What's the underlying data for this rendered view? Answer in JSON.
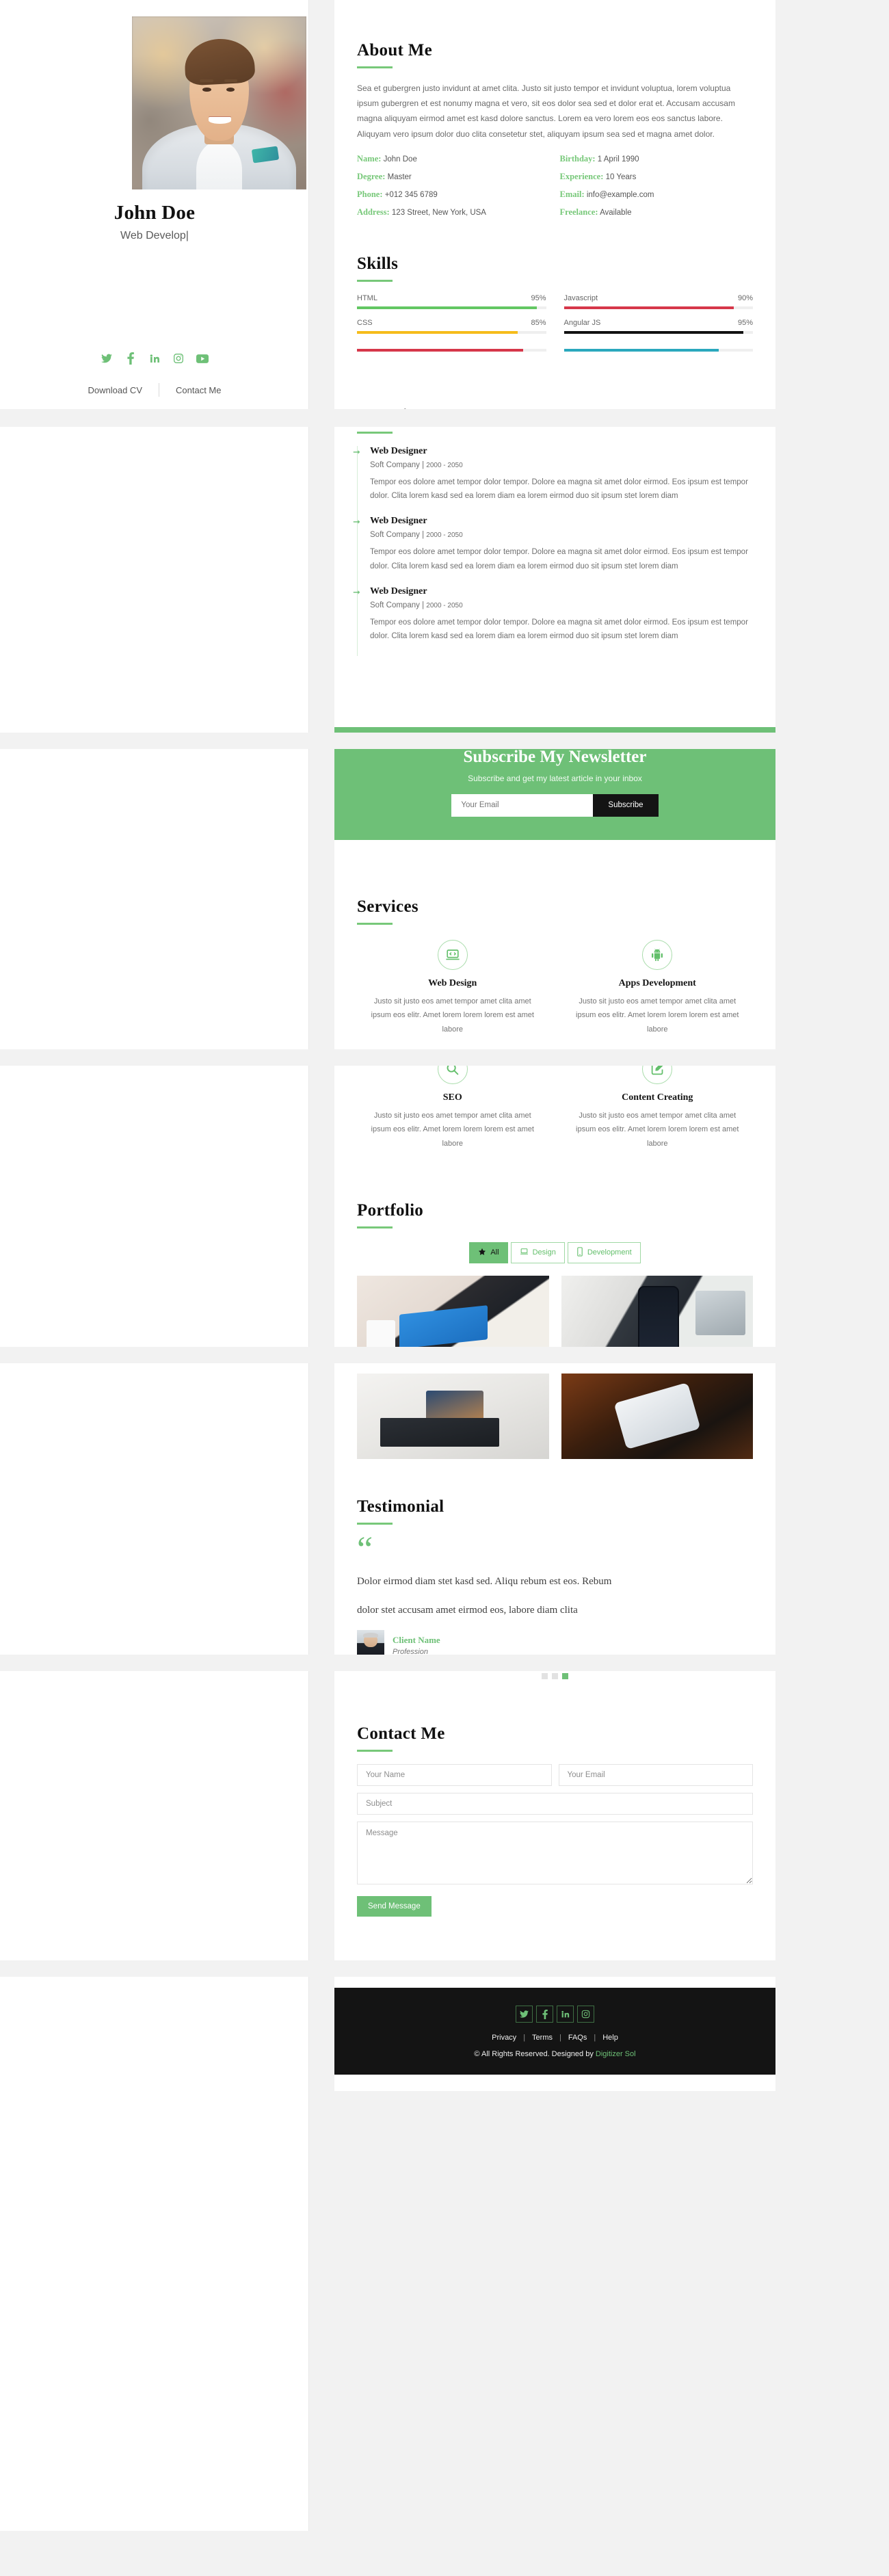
{
  "profile": {
    "name": "John Doe",
    "role": "Web Develop|",
    "socials": [
      "twitter-icon",
      "facebook-icon",
      "linkedin-icon",
      "instagram-icon",
      "youtube-icon"
    ],
    "download_cv": "Download CV",
    "contact_me": "Contact Me"
  },
  "about": {
    "title": "About Me",
    "paragraph": "Sea et gubergren justo invidunt at amet clita. Justo sit justo tempor et invidunt voluptua, lorem voluptua ipsum gubergren et est nonumy magna et vero, sit eos dolor sea sed et dolor erat et. Accusam accusam magna aliquyam eirmod amet est kasd dolore sanctus. Lorem ea vero lorem eos eos sanctus labore. Aliquyam vero ipsum dolor duo clita consetetur stet, aliquyam ipsum sea sed et magna amet dolor.",
    "fields": [
      {
        "label": "Name:",
        "value": "John Doe"
      },
      {
        "label": "Birthday:",
        "value": "1 April 1990"
      },
      {
        "label": "Degree:",
        "value": "Master"
      },
      {
        "label": "Experience:",
        "value": "10 Years"
      },
      {
        "label": "Phone:",
        "value": "+012 345 6789"
      },
      {
        "label": "Email:",
        "value": "info@example.com"
      },
      {
        "label": "Address:",
        "value": "123 Street, New York, USA"
      },
      {
        "label": "Freelance:",
        "value": "Available"
      }
    ]
  },
  "skills": {
    "title": "Skills",
    "items": [
      {
        "name": "HTML",
        "percent": "95%",
        "value": 95,
        "color": "#63c763"
      },
      {
        "name": "Javascript",
        "percent": "90%",
        "value": 90,
        "color": "#d6374a"
      },
      {
        "name": "CSS",
        "percent": "85%",
        "value": 85,
        "color": "#f5bc1b"
      },
      {
        "name": "Angular JS",
        "percent": "95%",
        "value": 95,
        "color": "#121212"
      }
    ],
    "clipped_row": [
      {
        "value": 88,
        "color": "#d6374a"
      },
      {
        "value": 82,
        "color": "#2aa8bd"
      }
    ]
  },
  "experience": {
    "title": "Expericence",
    "items": [
      {
        "role": "Web Designer",
        "company": "Soft Company",
        "years": "2000 - 2050",
        "desc": "Tempor eos dolore amet tempor dolor tempor. Dolore ea magna sit amet dolor eirmod. Eos ipsum est tempor dolor. Clita lorem kasd sed ea lorem diam ea lorem eirmod duo sit ipsum stet lorem diam"
      },
      {
        "role": "Web Designer",
        "company": "Soft Company",
        "years": "2000 - 2050",
        "desc": "Tempor eos dolore amet tempor dolor tempor. Dolore ea magna sit amet dolor eirmod. Eos ipsum est tempor dolor. Clita lorem kasd sed ea lorem diam ea lorem eirmod duo sit ipsum stet lorem diam"
      },
      {
        "role": "Web Designer",
        "company": "Soft Company",
        "years": "2000 - 2050",
        "desc": "Tempor eos dolore amet tempor dolor tempor. Dolore ea magna sit amet dolor eirmod. Eos ipsum est tempor dolor. Clita lorem kasd sed ea lorem diam ea lorem eirmod duo sit ipsum stet lorem diam"
      }
    ]
  },
  "newsletter": {
    "title": "Subscribe My Newsletter",
    "subtitle": "Subscribe and get my latest article in your inbox",
    "email_placeholder": "Your Email",
    "button": "Subscribe"
  },
  "services": {
    "title": "Services",
    "items": [
      {
        "icon": "laptop-code-icon",
        "name": "Web Design",
        "desc": "Justo sit justo eos amet tempor amet clita amet ipsum eos elitr. Amet lorem lorem lorem est amet labore"
      },
      {
        "icon": "android-icon",
        "name": "Apps Development",
        "desc": "Justo sit justo eos amet tempor amet clita amet ipsum eos elitr. Amet lorem lorem lorem est amet labore"
      },
      {
        "icon": "search-icon",
        "name": "SEO",
        "desc": "Justo sit justo eos amet tempor amet clita amet ipsum eos elitr. Amet lorem lorem lorem est amet labore"
      },
      {
        "icon": "pen-square-icon",
        "name": "Content Creating",
        "desc": "Justo sit justo eos amet tempor amet clita amet ipsum eos elitr. Amet lorem lorem lorem est amet labore"
      }
    ]
  },
  "portfolio": {
    "title": "Portfolio",
    "filters": [
      {
        "icon": "star-icon",
        "label": "All",
        "active": true
      },
      {
        "icon": "laptop-icon",
        "label": "Design",
        "active": false
      },
      {
        "icon": "mobile-icon",
        "label": "Development",
        "active": false
      }
    ]
  },
  "testimonial": {
    "title": "Testimonial",
    "quote_icon": "quote-left-icon",
    "quote_line1": "Dolor eirmod diam stet kasd sed. Aliqu rebum est eos. Rebum",
    "quote_line2": "dolor stet accusam amet eirmod eos, labore diam clita",
    "client_name": "Client Name",
    "client_profession": "Profession",
    "active_dot": 3,
    "dot_count": 3
  },
  "contact": {
    "title": "Contact Me",
    "name_placeholder": "Your Name",
    "email_placeholder": "Your Email",
    "subject_placeholder": "Subject",
    "message_placeholder": "Message",
    "submit": "Send Message"
  },
  "footer": {
    "socials": [
      "twitter-icon",
      "facebook-icon",
      "linkedin-icon",
      "instagram-icon"
    ],
    "links": [
      "Privacy",
      "Terms",
      "FAQs",
      "Help"
    ],
    "separator": "|",
    "copyright": "© All Rights Reserved. Designed by ",
    "brand": "Digitizer Sol"
  },
  "colors": {
    "accent": "#6ec077",
    "dark": "#141414",
    "page_bg": "#f2f2f2"
  }
}
